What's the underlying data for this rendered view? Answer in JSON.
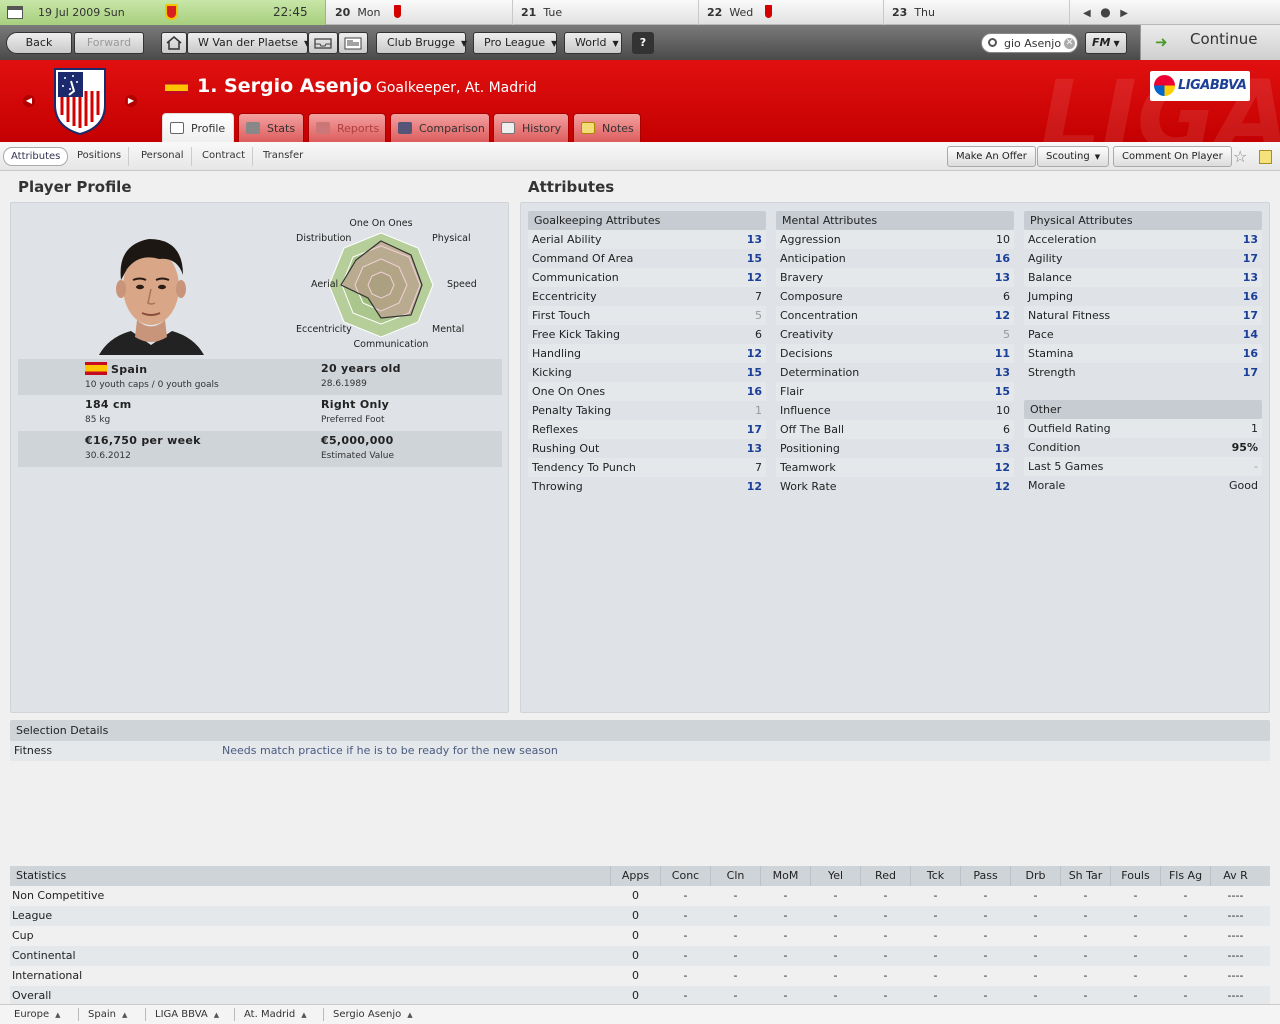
{
  "datebar": {
    "today_date": "19 Jul 2009  Sun",
    "time": "22:45",
    "days": [
      {
        "num": "20",
        "name": "Mon"
      },
      {
        "num": "21",
        "name": "Tue"
      },
      {
        "num": "22",
        "name": "Wed"
      },
      {
        "num": "23",
        "name": "Thu"
      }
    ]
  },
  "toolbar": {
    "back": "Back",
    "forward": "Forward",
    "manager": "W Van der Plaetse",
    "club": "Club Brugge",
    "league": "Pro League",
    "world": "World",
    "help": "?",
    "search_value": "gio Asenjo",
    "fm_menu": "FM",
    "continue": "Continue"
  },
  "header": {
    "player_name": "1. Sergio Asenjo",
    "player_role": "Goalkeeper, At. Madrid",
    "league_logo": "LIGABBVA",
    "watermark": "LIGA",
    "tabs": [
      "Profile",
      "Stats",
      "Reports",
      "Comparison",
      "History",
      "Notes"
    ]
  },
  "subnav": {
    "tabs": [
      "Attributes",
      "Positions",
      "Personal",
      "Contract",
      "Transfer"
    ],
    "actions": [
      "Make An Offer",
      "Scouting",
      "Comment On Player"
    ]
  },
  "profile": {
    "title": "Player Profile",
    "radar_labels": [
      "One On Ones",
      "Physical",
      "Speed",
      "Mental",
      "Communication",
      "Eccentricity",
      "Aerial",
      "Distribution"
    ],
    "nationality": "Spain",
    "caps": "10 youth caps / 0 youth goals",
    "age": "20 years old",
    "dob": "28.6.1989",
    "height": "184 cm",
    "weight": "85 kg",
    "foot": "Right Only",
    "foot_label": "Preferred Foot",
    "wage": "€16,750 per week",
    "contract_end": "30.6.2012",
    "value": "€5,000,000",
    "value_label": "Estimated Value"
  },
  "attributes": {
    "title": "Attributes",
    "goalkeeping": {
      "title": "Goalkeeping Attributes",
      "items": [
        {
          "name": "Aerial Ability",
          "value": "13"
        },
        {
          "name": "Command Of Area",
          "value": "15"
        },
        {
          "name": "Communication",
          "value": "12"
        },
        {
          "name": "Eccentricity",
          "value": "7"
        },
        {
          "name": "First Touch",
          "value": "5"
        },
        {
          "name": "Free Kick Taking",
          "value": "6"
        },
        {
          "name": "Handling",
          "value": "12"
        },
        {
          "name": "Kicking",
          "value": "15"
        },
        {
          "name": "One On Ones",
          "value": "16"
        },
        {
          "name": "Penalty Taking",
          "value": "1"
        },
        {
          "name": "Reflexes",
          "value": "17"
        },
        {
          "name": "Rushing Out",
          "value": "13"
        },
        {
          "name": "Tendency To Punch",
          "value": "7"
        },
        {
          "name": "Throwing",
          "value": "12"
        }
      ]
    },
    "mental": {
      "title": "Mental Attributes",
      "items": [
        {
          "name": "Aggression",
          "value": "10"
        },
        {
          "name": "Anticipation",
          "value": "16"
        },
        {
          "name": "Bravery",
          "value": "13"
        },
        {
          "name": "Composure",
          "value": "6"
        },
        {
          "name": "Concentration",
          "value": "12"
        },
        {
          "name": "Creativity",
          "value": "5"
        },
        {
          "name": "Decisions",
          "value": "11"
        },
        {
          "name": "Determination",
          "value": "13"
        },
        {
          "name": "Flair",
          "value": "15"
        },
        {
          "name": "Influence",
          "value": "10"
        },
        {
          "name": "Off The Ball",
          "value": "6"
        },
        {
          "name": "Positioning",
          "value": "13"
        },
        {
          "name": "Teamwork",
          "value": "12"
        },
        {
          "name": "Work Rate",
          "value": "12"
        }
      ]
    },
    "physical": {
      "title": "Physical Attributes",
      "items": [
        {
          "name": "Acceleration",
          "value": "13"
        },
        {
          "name": "Agility",
          "value": "17"
        },
        {
          "name": "Balance",
          "value": "13"
        },
        {
          "name": "Jumping",
          "value": "16"
        },
        {
          "name": "Natural Fitness",
          "value": "17"
        },
        {
          "name": "Pace",
          "value": "14"
        },
        {
          "name": "Stamina",
          "value": "16"
        },
        {
          "name": "Strength",
          "value": "17"
        }
      ]
    },
    "other": {
      "title": "Other",
      "items": [
        {
          "name": "Outfield Rating",
          "value": "1"
        },
        {
          "name": "Condition",
          "value": "95%"
        },
        {
          "name": "Last 5 Games",
          "value": "-"
        },
        {
          "name": "Morale",
          "value": "Good"
        }
      ]
    }
  },
  "selection": {
    "title": "Selection Details",
    "label": "Fitness",
    "text": "Needs match practice if he is to be ready for the new season"
  },
  "stats": {
    "title": "Statistics",
    "columns": [
      "Apps",
      "Conc",
      "Cln",
      "MoM",
      "Yel",
      "Red",
      "Tck",
      "Pass",
      "Drb",
      "Sh Tar",
      "Fouls",
      "Fls Ag",
      "Av R"
    ],
    "rows": [
      {
        "name": "Non Competitive",
        "apps": "0"
      },
      {
        "name": "League",
        "apps": "0"
      },
      {
        "name": "Cup",
        "apps": "0"
      },
      {
        "name": "Continental",
        "apps": "0"
      },
      {
        "name": "International",
        "apps": "0"
      },
      {
        "name": "Overall",
        "apps": "0"
      }
    ],
    "dash": "-",
    "avr_dash": "----"
  },
  "breadcrumbs": [
    "Europe",
    "Spain",
    "LIGA BBVA",
    "At. Madrid",
    "Sergio Asenjo"
  ],
  "colors": {
    "header_red": "#d40000",
    "value_blue": "#1a3f99",
    "today_green": "#a7cf7d"
  }
}
